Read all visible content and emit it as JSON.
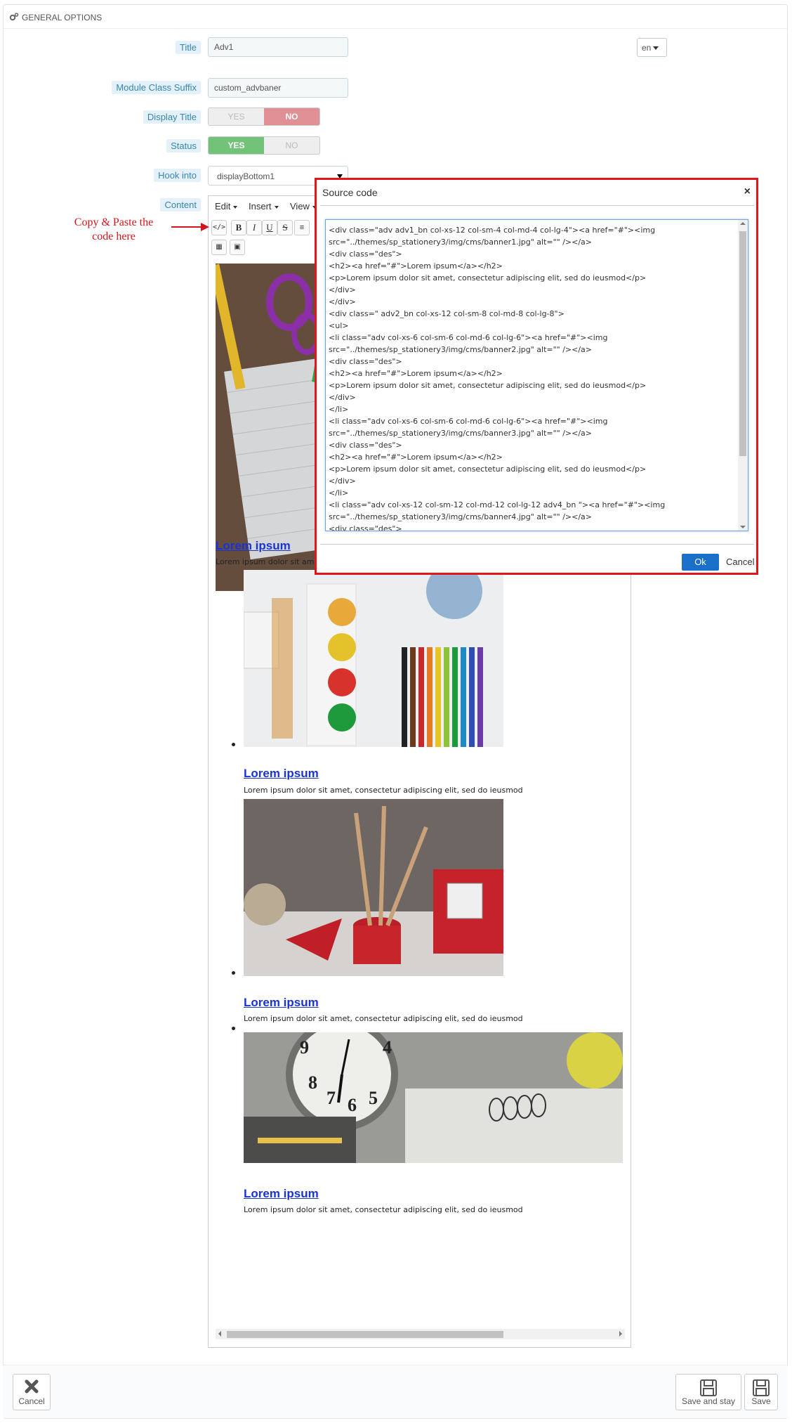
{
  "panel": {
    "heading": "GENERAL OPTIONS"
  },
  "form": {
    "title_label": "Title",
    "title_value": "Adv1",
    "lang": "en",
    "suffix_label": "Module Class Suffix",
    "suffix_value": "custom_advbaner",
    "display_title_label": "Display Title",
    "display_title": {
      "yes": "YES",
      "no": "NO",
      "selected": "NO"
    },
    "status_label": "Status",
    "status": {
      "yes": "YES",
      "no": "NO",
      "selected": "YES"
    },
    "hook_label": "Hook into",
    "hook_value": "displayBottom1",
    "content_label": "Content"
  },
  "editor": {
    "menu": [
      "Edit",
      "Insert",
      "View"
    ],
    "toolbar": {
      "bold": "B",
      "italic": "I",
      "underline": "U",
      "strike": "S"
    },
    "items": [
      {
        "title": "Lorem ipsum",
        "text": "Lorem ipsum dolor sit amet, consectetur adipiscing elit, sed do ieusmod"
      },
      {
        "title": "Lorem ipsum",
        "text": "Lorem ipsum dolor sit amet, consectetur adipiscing elit, sed do ieusmod"
      },
      {
        "title": "Lorem ipsum",
        "text": "Lorem ipsum dolor sit amet, consectetur adipiscing elit, sed do ieusmod"
      },
      {
        "title": "Lorem ipsum",
        "text": "Lorem ipsum dolor sit amet, consectetur adipiscing elit, sed do ieusmod"
      }
    ]
  },
  "annotation": {
    "line1": "Copy & Paste the",
    "line2": "code here"
  },
  "modal": {
    "title": "Source code",
    "close": "×",
    "ok": "Ok",
    "cancel": "Cancel",
    "code_lines": [
      "<div class=\"adv adv1_bn col-xs-12 col-sm-4 col-md-4 col-lg-4\"><a href=\"#\"><img",
      "src=\"../themes/sp_stationery3/img/cms/banner1.jpg\" alt=\"\" /></a>",
      "<div class=\"des\">",
      "<h2><a href=\"#\">Lorem ipsum</a></h2>",
      "<p>Lorem ipsum dolor sit amet, consectetur adipiscing elit, sed do ieusmod</p>",
      "</div>",
      "</div>",
      "<div class=\" adv2_bn col-xs-12 col-sm-8 col-md-8 col-lg-8\">",
      "<ul>",
      "<li class=\"adv col-xs-6 col-sm-6 col-md-6 col-lg-6\"><a href=\"#\"><img",
      "src=\"../themes/sp_stationery3/img/cms/banner2.jpg\" alt=\"\" /></a>",
      "<div class=\"des\">",
      "<h2><a href=\"#\">Lorem ipsum</a></h2>",
      "<p>Lorem ipsum dolor sit amet, consectetur adipiscing elit, sed do ieusmod</p>",
      "</div>",
      "</li>",
      "<li class=\"adv col-xs-6 col-sm-6 col-md-6 col-lg-6\"><a href=\"#\"><img",
      "src=\"../themes/sp_stationery3/img/cms/banner3.jpg\" alt=\"\" /></a>",
      "<div class=\"des\">",
      "<h2><a href=\"#\">Lorem ipsum</a></h2>",
      "<p>Lorem ipsum dolor sit amet, consectetur adipiscing elit, sed do ieusmod</p>",
      "</div>",
      "</li>",
      "<li class=\"adv col-xs-12 col-sm-12 col-md-12 col-lg-12 adv4_bn \"><a href=\"#\"><img",
      "src=\"../themes/sp_stationery3/img/cms/banner4.jpg\" alt=\"\" /></a>",
      "<div class=\"des\">"
    ]
  },
  "footer": {
    "cancel": "Cancel",
    "save_stay": "Save and stay",
    "save": "Save"
  }
}
